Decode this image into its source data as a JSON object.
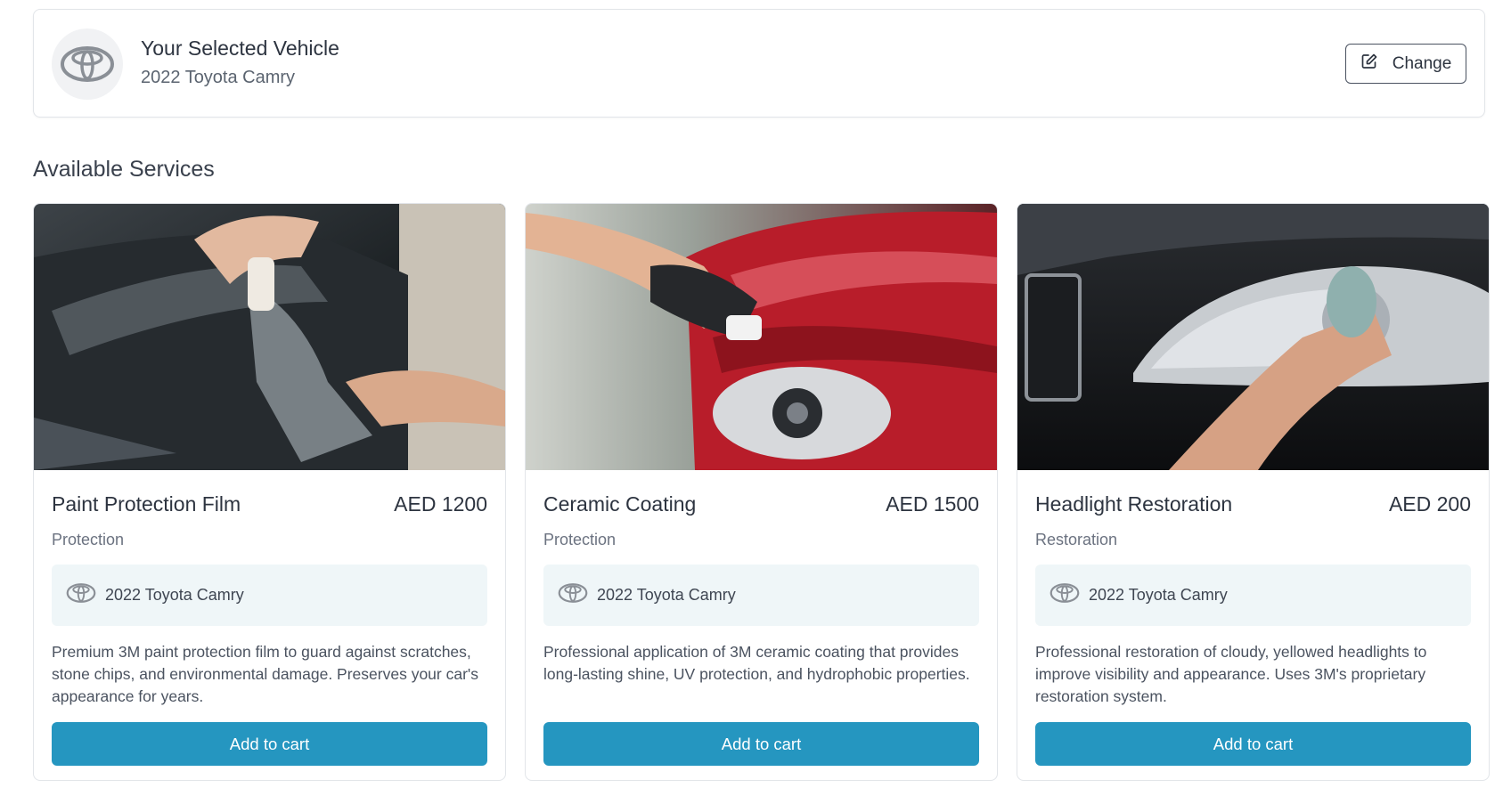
{
  "vehicle": {
    "heading": "Your Selected Vehicle",
    "name": "2022 Toyota Camry",
    "change_label": "Change",
    "brand_icon": "toyota-logo"
  },
  "section_title": "Available Services",
  "services": [
    {
      "name": "Paint Protection Film",
      "price": "AED 1200",
      "category": "Protection",
      "vehicle": "2022 Toyota Camry",
      "description": "Premium 3M paint protection film to guard against scratches, stone chips, and environmental damage. Preserves your car's appearance for years.",
      "button": "Add to cart"
    },
    {
      "name": "Ceramic Coating",
      "price": "AED 1500",
      "category": "Protection",
      "vehicle": "2022 Toyota Camry",
      "description": "Professional application of 3M ceramic coating that provides long-lasting shine, UV protection, and hydrophobic properties.",
      "button": "Add to cart"
    },
    {
      "name": "Headlight Restoration",
      "price": "AED 200",
      "category": "Restoration",
      "vehicle": "2022 Toyota Camry",
      "description": "Professional restoration of cloudy, yellowed headlights to improve visibility and appearance. Uses 3M's proprietary restoration system.",
      "button": "Add to cart"
    }
  ],
  "colors": {
    "accent": "#2596c0",
    "chip_bg": "#eff6f8",
    "border": "#e2e5e9"
  }
}
